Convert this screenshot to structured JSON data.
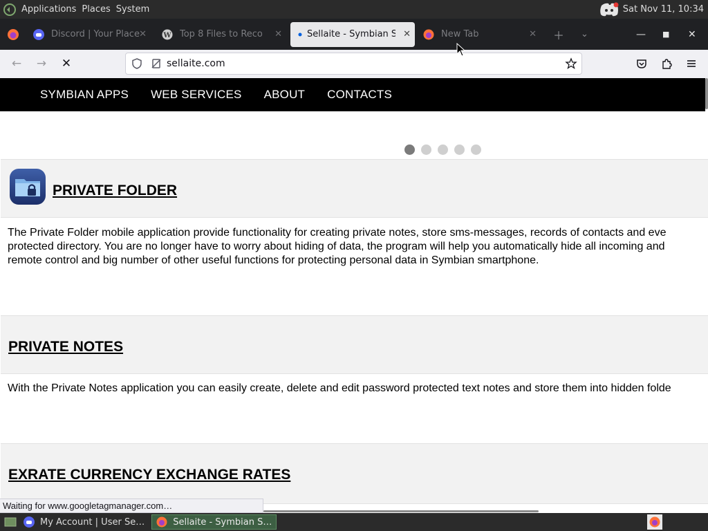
{
  "panel": {
    "menus": [
      "Applications",
      "Places",
      "System"
    ],
    "clock": "Sat Nov 11, 10:34"
  },
  "tabs": [
    {
      "title": "Discord | Your Place",
      "icon": "discord-icon",
      "active": false
    },
    {
      "title": "Top 8 Files to Reco",
      "icon": "wordpress-icon",
      "active": false
    },
    {
      "title": "Sellaite - Symbian Sof",
      "icon": "loading-dot-icon",
      "active": true
    },
    {
      "title": "New Tab",
      "icon": "firefox-icon",
      "active": false
    }
  ],
  "urlbar": {
    "url": "sellaite.com"
  },
  "site": {
    "nav": [
      "SYMBIAN APPS",
      "WEB SERVICES",
      "ABOUT",
      "CONTACTS"
    ],
    "sections": [
      {
        "title": "PRIVATE FOLDER",
        "lines": [
          "The Private Folder mobile application provide functionality for creating private notes, store sms-messages, records of contacts and eve",
          "protected directory. You are no longer have to worry about hiding of data, the program will help you automatically hide all incoming and",
          "remote control and big number of other useful functions for protecting personal data in Symbian smartphone."
        ]
      },
      {
        "title": "PRIVATE NOTES",
        "lines": [
          "With the Private Notes application you can easily create, delete and edit password protected text notes and store them into hidden folde"
        ]
      },
      {
        "title": "EXRATE CURRENCY EXCHANGE RATES",
        "lines": []
      }
    ]
  },
  "status": "Waiting for www.googletagmanager.com…",
  "taskbar": [
    {
      "label": "My Account | User Se…",
      "icon": "discord-icon",
      "active": false
    },
    {
      "label": "Sellaite - Symbian S…",
      "icon": "firefox-icon",
      "active": true
    }
  ],
  "colors": {
    "site_nav_bg": "#000000",
    "section_head_bg": "#f2f2f2",
    "active_task": "#3d5f43"
  }
}
